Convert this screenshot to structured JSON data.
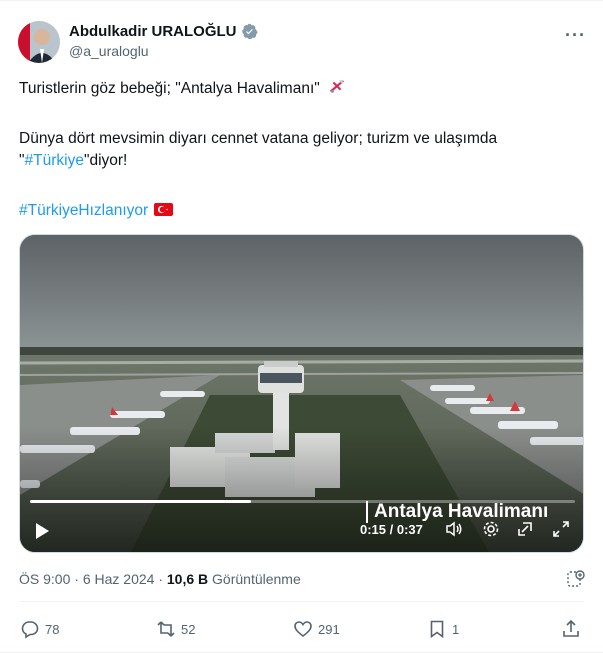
{
  "author": {
    "name": "Abdulkadir URALOĞLU",
    "handle": "@a_uraloglu"
  },
  "tweet": {
    "line1": "Turistlerin göz bebeği; \"Antalya Havalimanı\"",
    "line2": "Dünya dört mevsimin diyarı cennet vatana geliyor; turizm ve ulaşımda",
    "line3_prefix": "\"",
    "line3_hashtag": "#Türkiye",
    "line3_suffix": "\"diyor!",
    "hashtag2": "#TürkiyeHızlanıyor"
  },
  "video": {
    "overlay_title": "Antalya Havalimanı",
    "time": "0:15 / 0:37",
    "progress": 0.405
  },
  "meta": {
    "time": "ÖS 9:00",
    "date": "6 Haz 2024",
    "views_count": "10,6 B",
    "views_label": "Görüntülenme"
  },
  "actions": {
    "replies": "78",
    "reposts": "52",
    "likes": "291",
    "bookmarks": "1"
  },
  "colors": {
    "accent": "#1d9bf0",
    "flag_red": "#e30a17"
  }
}
